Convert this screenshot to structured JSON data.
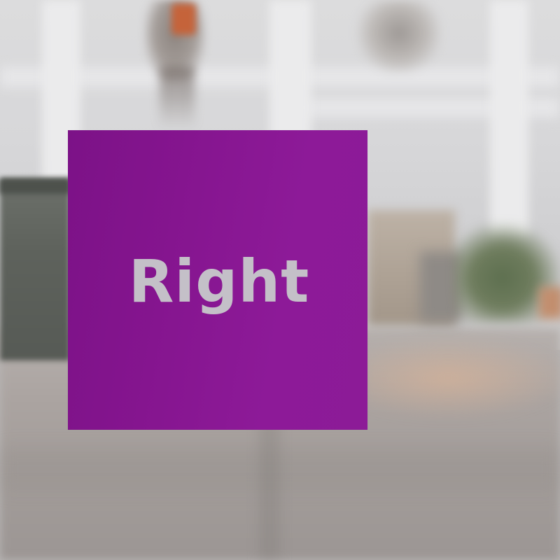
{
  "sign": {
    "label": "Right",
    "background_color": "#8b1896",
    "text_color": "#c4c0c8"
  }
}
